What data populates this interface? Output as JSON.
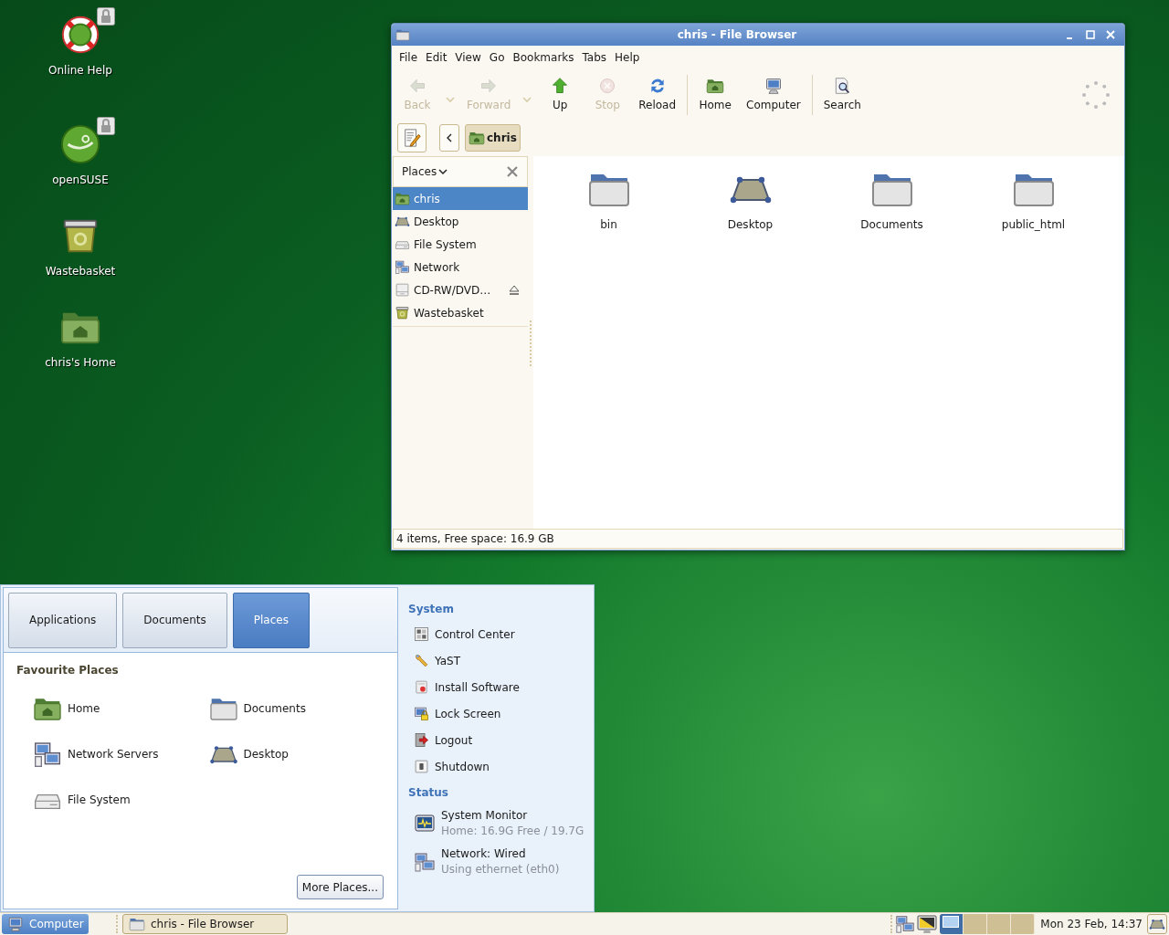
{
  "desktop": {
    "icons": [
      {
        "label": "Online Help",
        "kind": "help",
        "locked": true
      },
      {
        "label": "openSUSE",
        "kind": "suse",
        "locked": true
      },
      {
        "label": "Wastebasket",
        "kind": "trash",
        "locked": false
      },
      {
        "label": "chris's Home",
        "kind": "home",
        "locked": false
      }
    ]
  },
  "file_browser": {
    "title": "chris - File Browser",
    "menu": [
      "File",
      "Edit",
      "View",
      "Go",
      "Bookmarks",
      "Tabs",
      "Help"
    ],
    "toolbar": [
      [
        {
          "label": "Back",
          "kind": "back",
          "disabled": true,
          "dropdown": true
        },
        {
          "label": "Forward",
          "kind": "forward",
          "disabled": true,
          "dropdown": true
        },
        {
          "label": "Up",
          "kind": "up",
          "disabled": false,
          "dropdown": false
        },
        {
          "label": "Stop",
          "kind": "stop",
          "disabled": true,
          "dropdown": false
        },
        {
          "label": "Reload",
          "kind": "reload",
          "disabled": false,
          "dropdown": false
        }
      ],
      [
        {
          "label": "Home",
          "kind": "home",
          "disabled": false,
          "dropdown": false
        },
        {
          "label": "Computer",
          "kind": "computer",
          "disabled": false,
          "dropdown": false
        }
      ],
      [
        {
          "label": "Search",
          "kind": "search",
          "disabled": false,
          "dropdown": false
        }
      ]
    ],
    "path": [
      {
        "label": "chris",
        "selected": true
      }
    ],
    "sidebar": {
      "title": "Places",
      "items": [
        {
          "label": "chris",
          "kind": "home",
          "selected": true,
          "ejectable": false
        },
        {
          "label": "Desktop",
          "kind": "desktop",
          "selected": false,
          "ejectable": false
        },
        {
          "label": "File System",
          "kind": "drive",
          "selected": false,
          "ejectable": false
        },
        {
          "label": "Network",
          "kind": "network",
          "selected": false,
          "ejectable": false
        },
        {
          "label": "CD-RW/DVD…",
          "kind": "optical",
          "selected": false,
          "ejectable": true
        },
        {
          "label": "Wastebasket",
          "kind": "trash",
          "selected": false,
          "ejectable": false
        }
      ]
    },
    "files": [
      {
        "name": "bin",
        "kind": "folder"
      },
      {
        "name": "Desktop",
        "kind": "desktop"
      },
      {
        "name": "Documents",
        "kind": "folder"
      },
      {
        "name": "public_html",
        "kind": "folder"
      }
    ],
    "status_bar": "4 items, Free space: 16.9 GB"
  },
  "menu": {
    "tabs": [
      {
        "label": "Applications",
        "selected": false
      },
      {
        "label": "Documents",
        "selected": false
      },
      {
        "label": "Places",
        "selected": true
      }
    ],
    "favourites": {
      "title": "Favourite Places",
      "items": [
        {
          "label": "Home",
          "kind": "home"
        },
        {
          "label": "Documents",
          "kind": "folder"
        },
        {
          "label": "Network Servers",
          "kind": "network"
        },
        {
          "label": "Desktop",
          "kind": "desktop"
        },
        {
          "label": "File System",
          "kind": "drive"
        }
      ]
    },
    "more_button": "More Places...",
    "sections": [
      {
        "title": "System",
        "items": [
          {
            "label": "Control Center",
            "kind": "control"
          },
          {
            "label": "YaST",
            "kind": "yast"
          },
          {
            "label": "Install Software",
            "kind": "install"
          },
          {
            "label": "Lock Screen",
            "kind": "lock"
          },
          {
            "label": "Logout",
            "kind": "logout"
          },
          {
            "label": "Shutdown",
            "kind": "shutdown"
          }
        ]
      },
      {
        "title": "Status",
        "items": [
          {
            "label": "System Monitor",
            "detail": "Home: 16.9G Free / 19.7G",
            "kind": "sysmon"
          },
          {
            "label": "Network: Wired",
            "detail": "Using ethernet (eth0)",
            "kind": "network"
          }
        ]
      }
    ]
  },
  "taskbar": {
    "menu_button": "Computer",
    "windows": [
      "chris - File Browser"
    ],
    "workspaces": [
      {
        "selected": true
      },
      {
        "selected": false
      },
      {
        "selected": false
      },
      {
        "selected": false
      }
    ],
    "clock": "Mon 23 Feb, 14:37"
  }
}
